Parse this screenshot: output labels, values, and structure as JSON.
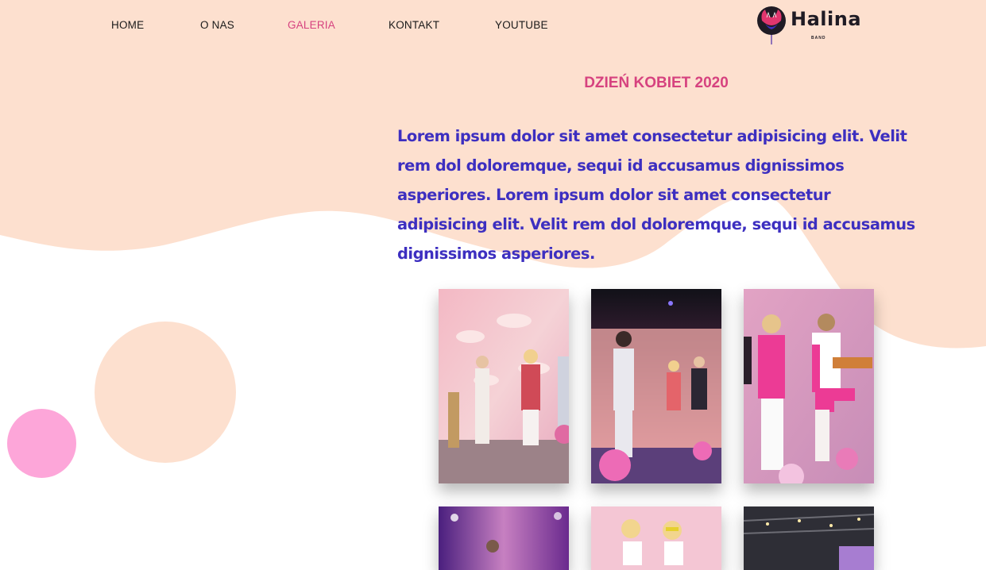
{
  "nav": {
    "items": [
      {
        "label": "HOME"
      },
      {
        "label": "O NAS"
      },
      {
        "label": "GALERIA",
        "active": true
      },
      {
        "label": "KONTAKT"
      },
      {
        "label": "YOUTUBE"
      }
    ]
  },
  "logo": {
    "text": "Halina",
    "subtext": "BAND"
  },
  "gallery": {
    "title": "DZIEŃ KOBIET 2020",
    "intro": "Lorem ipsum dolor sit amet consectetur adipisicing elit. Velit rem dol doloremque, sequi id accusamus dignissimos asperiores. Lorem ipsum dolor sit amet consectetur adipisicing elit. Velit rem dol doloremque, sequi id accusamus dignissimos asperiores.",
    "photo_count_visible": 6
  },
  "colors": {
    "background_peach": "#fde0cf",
    "accent_pink": "#d6427f",
    "text_blue": "#3d2fc0",
    "bubble_pink": "#fda6d9"
  }
}
